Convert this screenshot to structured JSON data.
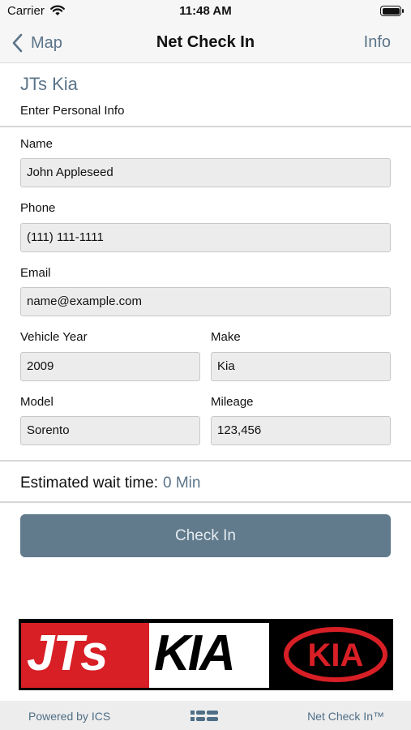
{
  "status_bar": {
    "carrier": "Carrier",
    "time": "11:48 AM"
  },
  "nav": {
    "back_label": "Map",
    "title": "Net Check In",
    "right_label": "Info"
  },
  "header": {
    "store_name": "JTs Kia",
    "subtitle": "Enter Personal Info"
  },
  "form": {
    "name": {
      "label": "Name",
      "value": "John Appleseed"
    },
    "phone": {
      "label": "Phone",
      "value": "(111) 111-1111"
    },
    "email": {
      "label": "Email",
      "value": "name@example.com"
    },
    "vehicle_year": {
      "label": "Vehicle Year",
      "value": "2009"
    },
    "make": {
      "label": "Make",
      "value": "Kia"
    },
    "model": {
      "label": "Model",
      "value": "Sorento"
    },
    "mileage": {
      "label": "Mileage",
      "value": "123,456"
    }
  },
  "wait": {
    "label": "Estimated wait time:",
    "value": "0 Min"
  },
  "check_in_button": "Check In",
  "banner": {
    "left_text": "JTs",
    "middle_text": "KIA",
    "logo_text": "KIA"
  },
  "footer": {
    "powered_by": "Powered by ICS",
    "product": "Net Check In™",
    "icon": "ics-logo-icon"
  },
  "colors": {
    "accent": "#5b7489",
    "button": "#617b8c",
    "banner_red": "#d81f26"
  }
}
